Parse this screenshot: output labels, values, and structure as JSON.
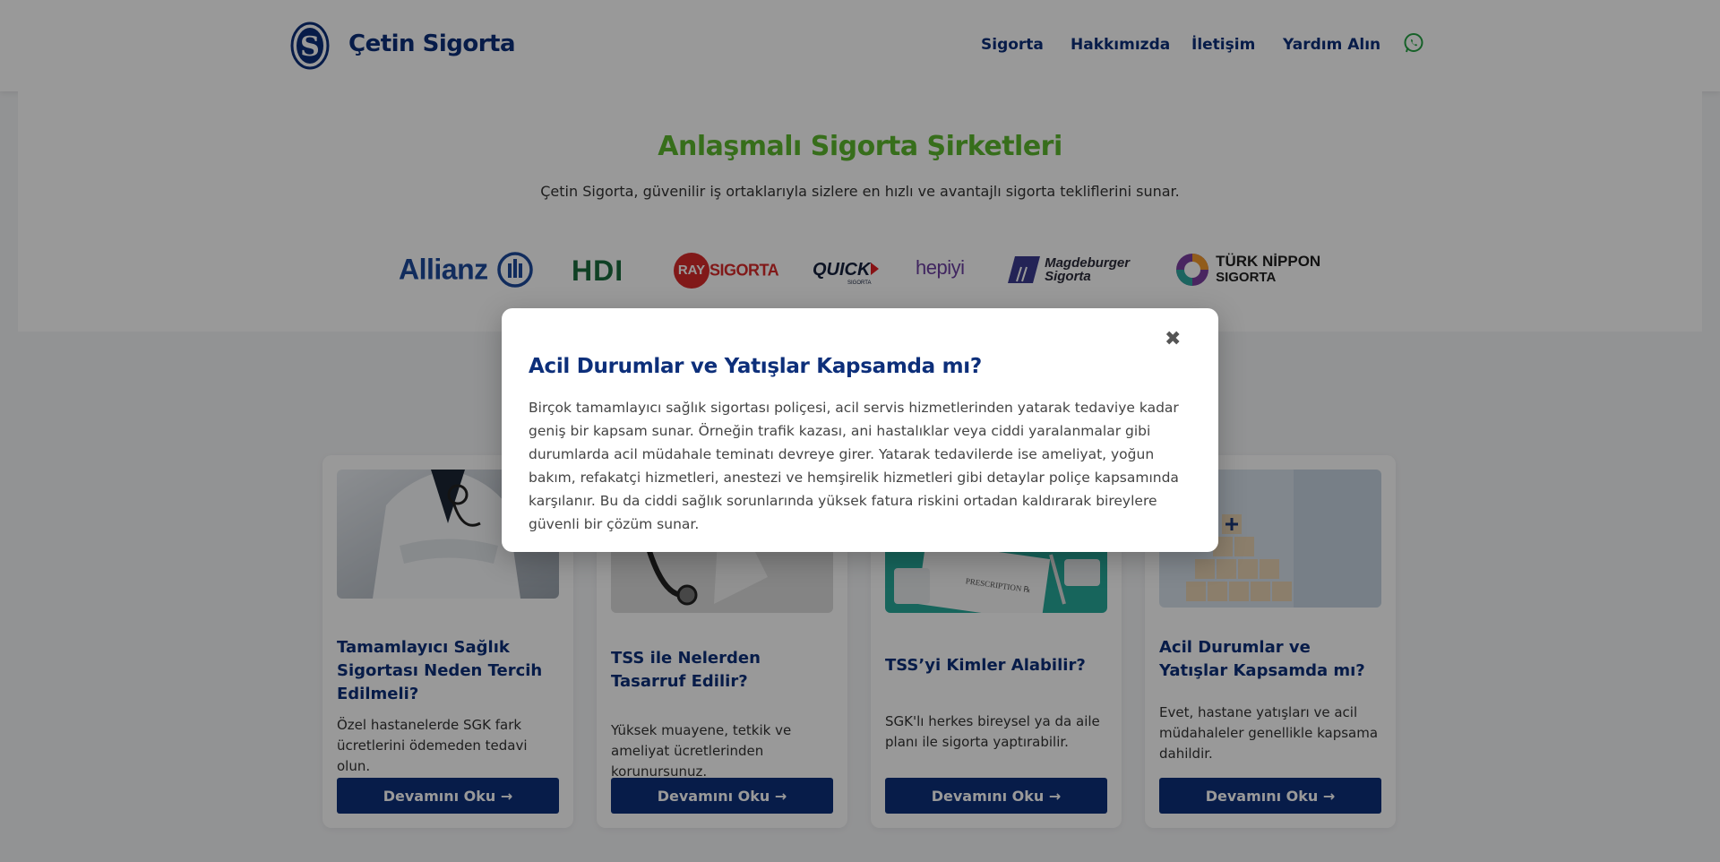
{
  "header": {
    "brand": "Çetin Sigorta",
    "nav": [
      "Sigorta",
      "Hakkımızda",
      "İletişim",
      "Yardım Alın"
    ]
  },
  "partners": {
    "title": "Anlaşmalı Sigorta Şirketleri",
    "subtitle": "Çetin Sigorta, güvenilir iş ortaklarıyla sizlere en hızlı ve avantajlı sigorta tekliflerini sunar.",
    "logos": [
      "Allianz",
      "HDI",
      "RAY",
      "SIGORTA",
      "QUICK",
      "SIGORTA",
      "hepiyi",
      "Magdeburger",
      "Sigorta",
      "TÜRK NİPPON",
      "SIGORTA"
    ]
  },
  "cards": [
    {
      "title": "Tamamlayıcı Sağlık Sigortası Neden Tercih Edilmeli?",
      "desc": "Özel hastanelerde SGK fark ücretlerini ödemeden tedavi olun.",
      "button": "Devamını Oku →"
    },
    {
      "title": "TSS ile Nelerden Tasarruf Edilir?",
      "desc": "Yüksek muayene, tetkik ve ameliyat ücretlerinden korunursunuz.",
      "button": "Devamını Oku →"
    },
    {
      "title": "TSS’yi Kimler Alabilir?",
      "desc": "SGK'lı herkes bireysel ya da aile planı ile sigorta yaptırabilir.",
      "button": "Devamını Oku →"
    },
    {
      "title": "Acil Durumlar ve Yatışlar Kapsamda mı?",
      "desc": "Evet, hastane yatışları ve acil müdahaleler genellikle kapsama dahildir.",
      "button": "Devamını Oku →"
    }
  ],
  "modal": {
    "close": "✖",
    "title": "Acil Durumlar ve Yatışlar Kapsamda mı?",
    "body": "Birçok tamamlayıcı sağlık sigortası poliçesi, acil servis hizmetlerinden yatarak tedaviye kadar geniş bir kapsam sunar. Örneğin trafik kazası, ani hastalıklar veya ciddi yaralanmalar gibi durumlarda acil müdahale teminatı devreye girer. Yatarak tedavilerde ise ameliyat, yoğun bakım, refakatçi hizmetleri, anestezi ve hemşirelik hizmetleri gibi detaylar poliçe kapsamında karşılanır. Bu da ciddi sağlık sorunlarında yüksek fatura riskini ortadan kaldırarak bireylere güvenli bir çözüm sunar."
  },
  "colors": {
    "brand": "#0d2f7a",
    "accent_green": "#5cb82e",
    "whatsapp": "#25a244"
  },
  "icons": [
    "logo-mark-icon",
    "whatsapp-icon",
    "close-icon",
    "arrow-right-icon"
  ]
}
